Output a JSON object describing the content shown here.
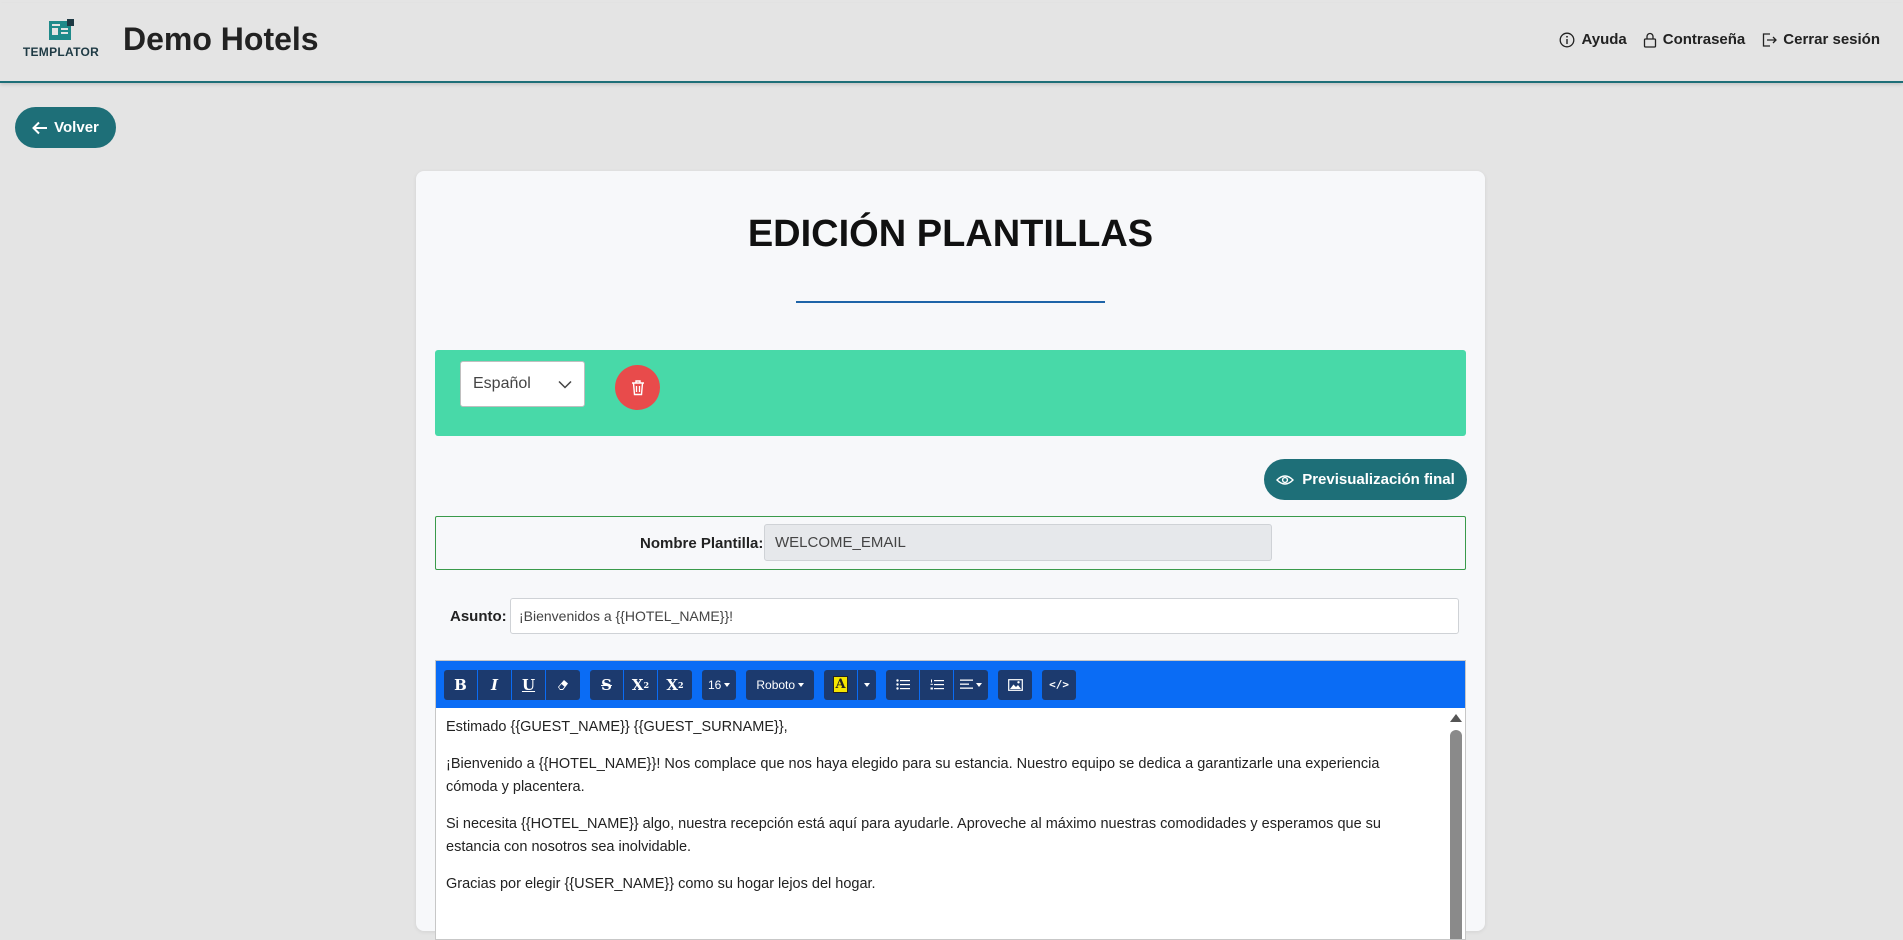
{
  "header": {
    "logo_text": "TEMPLATOR",
    "app_title": "Demo Hotels",
    "actions": [
      {
        "label": "Ayuda",
        "icon": "info-icon"
      },
      {
        "label": "Contraseña",
        "icon": "lock-icon"
      },
      {
        "label": "Cerrar sesión",
        "icon": "logout-icon"
      }
    ]
  },
  "back_button": {
    "label": "Volver",
    "icon": "arrow-left-icon"
  },
  "page": {
    "title": "EDICIÓN PLANTILLAS"
  },
  "language": {
    "selected": "Español",
    "delete_icon": "trash-icon"
  },
  "preview_button": {
    "label": "Previsualización final",
    "icon": "eye-icon"
  },
  "template_name": {
    "label": "Nombre Plantilla:",
    "value": "WELCOME_EMAIL"
  },
  "subject": {
    "label": "Asunto:",
    "value": "¡Bienvenidos a {{HOTEL_NAME}}!"
  },
  "toolbar": {
    "bold": "B",
    "italic": "I",
    "underline": "U",
    "eraser_icon": "eraser-icon",
    "strike": "S",
    "superscript": "X",
    "subscript": "X",
    "font_size": "16",
    "font_family": "Roboto",
    "highlight": "A",
    "list_unordered_icon": "list-unordered-icon",
    "list_ordered_icon": "list-ordered-icon",
    "align_icon": "align-icon",
    "image_icon": "image-icon",
    "code_label": "</>",
    "colors": {
      "bar": "#0a6cf5",
      "button": "#1c3a6e",
      "highlight": "#f5e600"
    }
  },
  "editor": {
    "paragraphs": [
      "Estimado {{GUEST_NAME}} {{GUEST_SURNAME}},",
      "¡Bienvenido a {{HOTEL_NAME}}! Nos complace que nos haya elegido para su estancia. Nuestro equipo se dedica a garantizarle una experiencia cómoda y placentera.",
      "Si necesita {{HOTEL_NAME}} algo, nuestra recepción está aquí para ayudarle. Aproveche al máximo nuestras comodidades y esperamos que su estancia con nosotros sea inolvidable.",
      "Gracias por elegir {{USER_NAME}} como su hogar lejos del hogar."
    ]
  },
  "colors": {
    "brand": "#1e6f78",
    "language_bar": "#48d9a8",
    "delete": "#e84b4b",
    "name_box_border": "#3a9a4a"
  }
}
